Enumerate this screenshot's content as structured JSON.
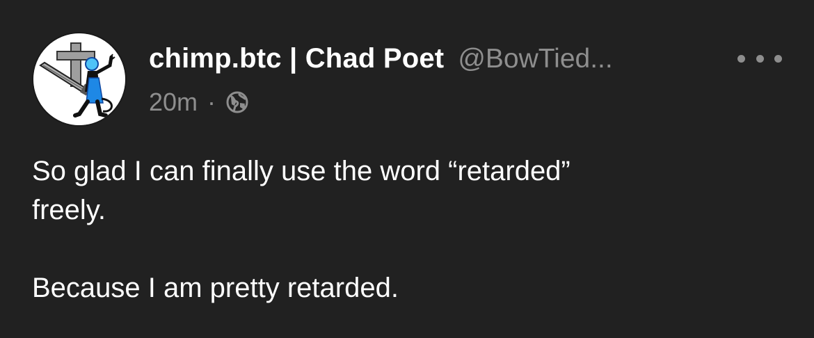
{
  "author": {
    "display_name": "chimp.btc | Chad Poet",
    "handle": "@BowTied...",
    "avatar_icon": "avatar-cross-sword-figure"
  },
  "meta": {
    "time": "20m",
    "separator": "·",
    "visibility_icon": "globe-icon"
  },
  "actions": {
    "more_icon": "more-horizontal-icon"
  },
  "body": {
    "line1": "So glad I can finally use the word “retarded”",
    "line2": "freely.",
    "line3": "Because I am pretty retarded."
  },
  "colors": {
    "background": "#212121",
    "primary_text": "#ffffff",
    "secondary_text": "#8e8e8e",
    "avatar_accent": "#1e88e5"
  }
}
